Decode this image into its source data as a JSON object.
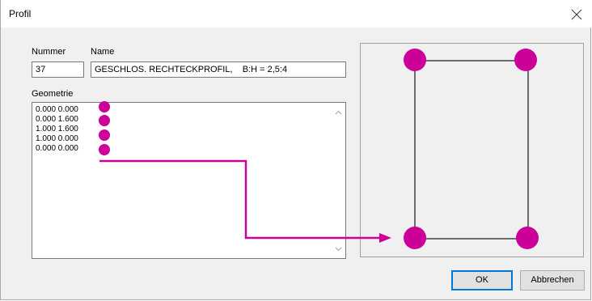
{
  "window": {
    "title": "Profil"
  },
  "fields": {
    "nummer_label": "Nummer",
    "name_label": "Name",
    "nummer_value": "37",
    "name_value": "GESCHLOS. RECHTECKPROFIL,    B:H = 2,5:4",
    "geometrie_label": "Geometrie"
  },
  "geometrie_lines": [
    "0.000 0.000",
    "0.000 1.600",
    "1.000 1.600",
    "1.000 0.000",
    "0.000 0.000"
  ],
  "buttons": {
    "ok": "OK",
    "cancel": "Abbrechen"
  },
  "colors": {
    "annotation": "#cc0099",
    "profile_line": "#404040"
  },
  "icons": [
    "close-icon",
    "scroll-up-arrow-icon",
    "scroll-down-arrow-icon"
  ]
}
